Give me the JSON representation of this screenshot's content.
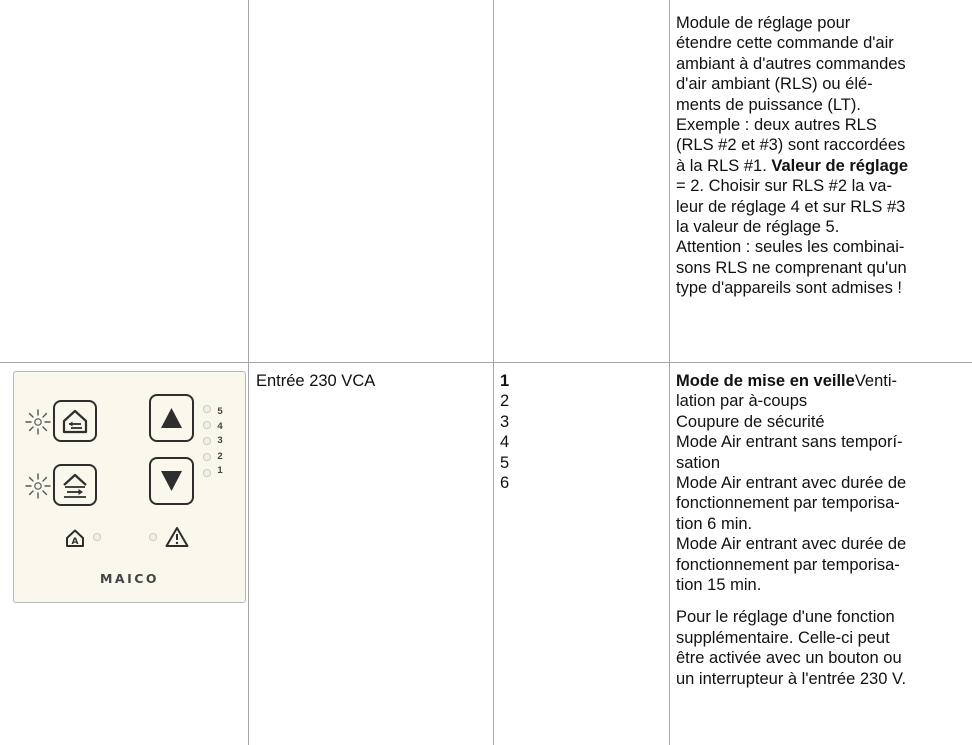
{
  "table": {
    "row1": {
      "description_lines": [
        "Module de réglage pour",
        "étendre cette commande d'air",
        "ambiant à d'autres commandes",
        "d'air ambiant (RLS) ou élé-",
        "ments de puissance (LT).",
        "Exemple : deux autres RLS",
        "(RLS #2 et #3) sont raccordées",
        "à la RLS #1."
      ],
      "description_bold": "Valeur de réglage",
      "description_after_bold": "= 2. Choisir sur RLS #2 la va-",
      "description_rest_lines": [
        "leur de réglage 4 et sur RLS #3",
        "la valeur de réglage 5.",
        "Attention : seules les combinai-",
        "sons RLS ne comprenant qu'un",
        "type d'appareils sont admises !"
      ]
    },
    "row2": {
      "input_label": "Entrée 230 VCA",
      "setting_values": [
        "1",
        "2",
        "3",
        "4",
        "5",
        "6"
      ],
      "mode_bold": "Mode de mise en veille",
      "mode_first_rest": "Venti-",
      "mode_lines": [
        "lation par à-coups",
        "Coupure de sécurité",
        "Mode Air entrant sans temporí-",
        "sation",
        "Mode Air entrant avec durée de",
        "fonctionnement par temporisa-",
        "tion 6 min.",
        "Mode Air entrant avec durée de",
        "fonctionnement par temporisa-",
        "tion 15 min."
      ],
      "note_lines": [
        "Pour le réglage d'une fonction",
        "supplémentaire. Celle-ci peut",
        "être activée avec un bouton ou",
        "un interrupteur à l'entrée 230 V."
      ]
    }
  },
  "device_panel": {
    "brand": "MAICO",
    "level_labels": [
      "5",
      "4",
      "3",
      "2",
      "1"
    ],
    "icons": [
      "sun-icon",
      "house-arrow-icon",
      "house-up-arrow-icon",
      "up-triangle-icon",
      "down-triangle-icon",
      "auto-house-icon",
      "warning-triangle-icon"
    ],
    "panel_color": "#faf8ed"
  }
}
